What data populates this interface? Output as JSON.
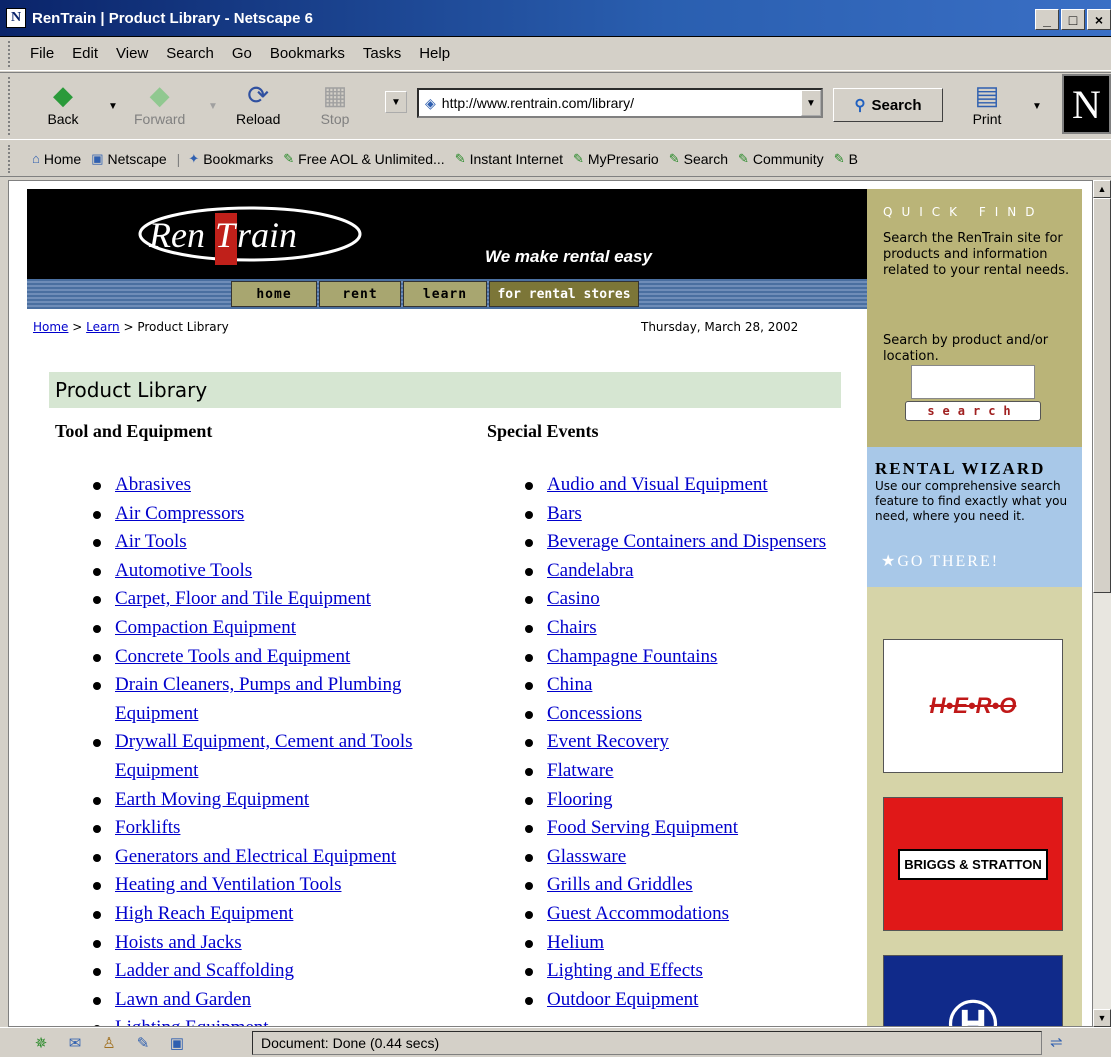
{
  "window": {
    "title": "RenTrain | Product Library - Netscape 6",
    "minimize": "_",
    "maximize": "□",
    "close": "×",
    "app_icon": "N"
  },
  "menu": [
    "File",
    "Edit",
    "View",
    "Search",
    "Go",
    "Bookmarks",
    "Tasks",
    "Help"
  ],
  "nav": {
    "back": "Back",
    "forward": "Forward",
    "reload": "Reload",
    "stop": "Stop",
    "print": "Print",
    "search": "Search"
  },
  "url": "http://www.rentrain.com/library/",
  "personal": [
    "Home",
    "Netscape",
    "Bookmarks",
    "Free AOL & Unlimited...",
    "Instant Internet",
    "MyPresario",
    "Search",
    "Community",
    "B"
  ],
  "page": {
    "tagline": "We make rental easy",
    "logo_left": "Ren",
    "logo_t": "T",
    "logo_right": "rain",
    "tabs": [
      "home",
      "rent",
      "learn",
      "for rental stores"
    ],
    "breadcrumb": {
      "home": "Home",
      "sep1": " > ",
      "learn": "Learn",
      "sep2": " > Product Library"
    },
    "date": "Thursday, March 28, 2002",
    "heading": "Product Library",
    "col1_title": "Tool and Equipment",
    "col2_title": "Special Events",
    "col1": [
      "Abrasives",
      "Air Compressors",
      "Air Tools",
      "Automotive Tools",
      "Carpet, Floor and Tile Equipment",
      "Compaction Equipment",
      "Concrete Tools and Equipment",
      "Drain Cleaners, Pumps and Plumbing Equipment",
      "Drywall Equipment, Cement and Tools Equipment",
      "Earth Moving Equipment",
      "Forklifts",
      "Generators and Electrical Equipment",
      "Heating and Ventilation Tools",
      "High Reach Equipment",
      "Hoists and Jacks",
      "Ladder and Scaffolding",
      "Lawn and Garden",
      "Lighting Equipment"
    ],
    "col2": [
      "Audio and Visual Equipment",
      "Bars",
      "Beverage Containers and Dispensers",
      "Candelabra",
      "Casino",
      "Chairs",
      "Champagne Fountains",
      "China",
      "Concessions",
      "Event Recovery",
      "Flatware",
      "Flooring",
      "Food Serving Equipment",
      "Glassware",
      "Grills and Griddles",
      "Guest Accommodations",
      "Helium",
      "Lighting and Effects",
      "Outdoor Equipment"
    ]
  },
  "sidebar": {
    "qf_title": "QUICK FIND",
    "qf_text": "Search the RenTrain site for products and information related to your rental needs.",
    "qf_text2": "Search by product and/or location.",
    "search_btn": "search",
    "wiz_title": "RENTAL WIZARD",
    "wiz_text": "Use our comprehensive search feature to find exactly what you need, where you need it.",
    "wiz_go": "GO THERE!",
    "ad1": "H•E•R•O",
    "ad2": "BRIGGS & STRATTON"
  },
  "status": "Document: Done (0.44 secs)"
}
